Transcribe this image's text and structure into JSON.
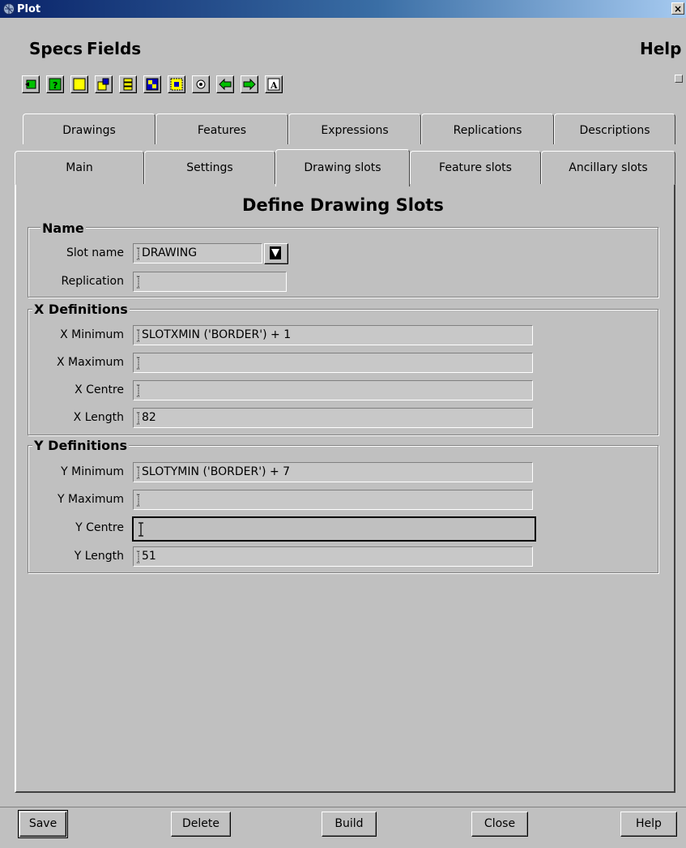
{
  "window": {
    "title": "Plot",
    "close_glyph": "×"
  },
  "menu": {
    "specs": "Specs",
    "fields": "Fields",
    "help": "Help"
  },
  "toolbar": {
    "icons": [
      "exit-icon",
      "help-icon",
      "new-icon",
      "copy-icon",
      "list-icon",
      "insert-icon",
      "select-icon",
      "locate-icon",
      "back-icon",
      "forward-icon",
      "text-icon"
    ]
  },
  "tabs": {
    "row1": [
      "Drawings",
      "Features",
      "Expressions",
      "Replications",
      "Descriptions"
    ],
    "row2": [
      "Main",
      "Settings",
      "Drawing slots",
      "Feature slots",
      "Ancillary slots"
    ],
    "active": "Drawing slots"
  },
  "panel": {
    "title": "Define Drawing Slots",
    "name_group": {
      "title": "Name",
      "slot_name_label": "Slot name",
      "slot_name_value": "DRAWING",
      "replication_label": "Replication",
      "replication_value": ""
    },
    "x_group": {
      "title": "X Definitions",
      "min_label": "X Minimum",
      "min_value": "SLOTXMIN ('BORDER') + 1",
      "max_label": "X Maximum",
      "max_value": "",
      "centre_label": "X Centre",
      "centre_value": "",
      "length_label": "X Length",
      "length_value": "82"
    },
    "y_group": {
      "title": "Y Definitions",
      "min_label": "Y Minimum",
      "min_value": "SLOTYMIN ('BORDER') + 7",
      "max_label": "Y Maximum",
      "max_value": "",
      "centre_label": "Y Centre",
      "centre_value": "",
      "length_label": "Y Length",
      "length_value": "51"
    }
  },
  "buttons": {
    "save": "Save",
    "delete": "Delete",
    "build": "Build",
    "close": "Close",
    "help": "Help"
  },
  "colors": {
    "background": "#c0c0c0",
    "titlebar": "#0a246a",
    "toolbar_icon_fill": "#ffff00",
    "toolbar_icon_green": "#00c000"
  }
}
